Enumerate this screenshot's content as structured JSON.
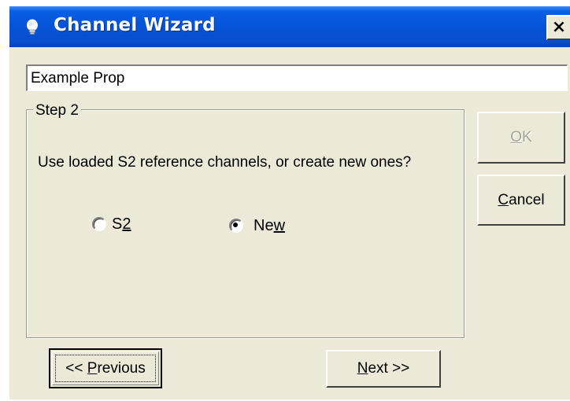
{
  "window": {
    "title": "Channel Wizard",
    "icon": "lightbulb-icon",
    "close_glyph": "×",
    "colors": {
      "titlebar": "#0553d6",
      "face": "#ece9d8"
    }
  },
  "name_field": {
    "value": "Example Prop"
  },
  "step": {
    "legend": "Step 2",
    "prompt": "Use loaded S2 reference channels, or create new ones?",
    "options": [
      {
        "label_pre": "S",
        "label_u": "2",
        "label_post": "",
        "selected": false
      },
      {
        "label_pre": "Ne",
        "label_u": "w",
        "label_post": "",
        "selected": true
      }
    ]
  },
  "buttons": {
    "ok": {
      "label_u": "O",
      "label_rest": "K",
      "enabled": false
    },
    "cancel": {
      "label_u": "C",
      "label_rest": "ancel"
    },
    "previous": {
      "label_pre": "<< ",
      "label_u": "P",
      "label_rest": "revious"
    },
    "next": {
      "label_u": "N",
      "label_rest": "ext >>"
    }
  }
}
